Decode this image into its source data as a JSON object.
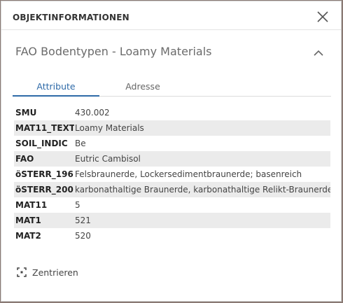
{
  "header": {
    "title": "OBJEKTINFORMATIONEN",
    "close_icon": "close-icon"
  },
  "section": {
    "title": "FAO Bodentypen - Loamy Materials",
    "collapse_icon": "chevron-up-icon"
  },
  "tabs": [
    {
      "label": "Attribute",
      "active": true
    },
    {
      "label": "Adresse",
      "active": false
    }
  ],
  "attributes": [
    {
      "key": "SMU",
      "value": "430.002"
    },
    {
      "key": "MAT11_TEXT",
      "value": "Loamy Materials"
    },
    {
      "key": "SOIL_INDIC",
      "value": "Be"
    },
    {
      "key": "FAO",
      "value": "Eutric Cambisol"
    },
    {
      "key": "öSTERR_196",
      "value": "Felsbraunerde, Lockersedimentbraunerde; basenreich"
    },
    {
      "key": "öSTERR_200",
      "value": "karbonathaltige Braunerde, karbonathaltige Relikt-Braunerde,"
    },
    {
      "key": "MAT11",
      "value": "5"
    },
    {
      "key": "MAT1",
      "value": "521"
    },
    {
      "key": "MAT2",
      "value": "520"
    }
  ],
  "actions": {
    "center_label": "Zentrieren",
    "center_icon": "center-focus-icon"
  },
  "colors": {
    "accent": "#2e6aa8",
    "row_alt": "#ebebeb"
  }
}
